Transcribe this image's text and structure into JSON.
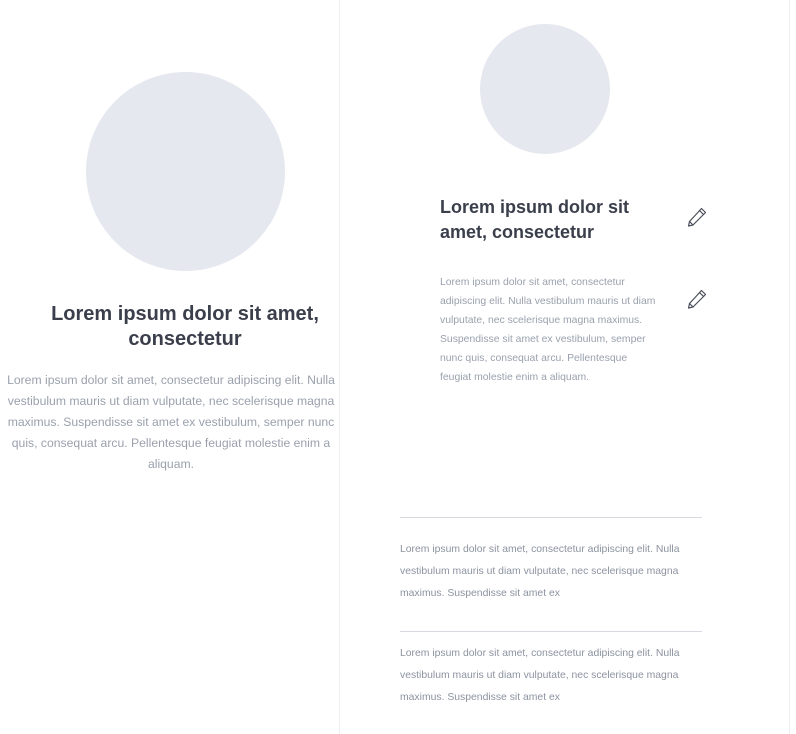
{
  "left_card": {
    "title": "Lorem ipsum dolor sit amet, consectetur",
    "body": "Lorem ipsum dolor sit amet, consectetur adipiscing elit. Nulla vestibulum mauris ut diam vulputate, nec scelerisque magna maximus. Suspendisse sit amet ex vestibulum, semper nunc quis, consequat arcu. Pellentesque feugiat molestie enim a aliquam."
  },
  "right_card": {
    "title": "Lorem ipsum dolor sit amet, consectetur",
    "description": "Lorem ipsum dolor sit amet, consectetur adipiscing elit. Nulla vestibulum mauris ut diam vulputate, nec scelerisque magna maximus. Suspendisse sit amet ex vestibulum, semper nunc quis, consequat arcu. Pellentesque feugiat molestie enim a aliquam.",
    "edit_icon": "pencil-icon"
  },
  "list": {
    "items": [
      "Lorem ipsum dolor sit amet, consectetur adipiscing elit. Nulla vestibulum mauris ut diam vulputate, nec scelerisque magna maximus. Suspendisse sit amet ex",
      "Lorem ipsum dolor sit amet, consectetur adipiscing elit. Nulla vestibulum mauris ut diam vulputate, nec scelerisque magna maximus. Suspendisse sit amet ex"
    ]
  },
  "colors": {
    "avatar_placeholder": "#e5e8ef",
    "title_text": "#3a3f4b",
    "body_text": "#9aa1ad",
    "divider": "#d6d9df"
  }
}
